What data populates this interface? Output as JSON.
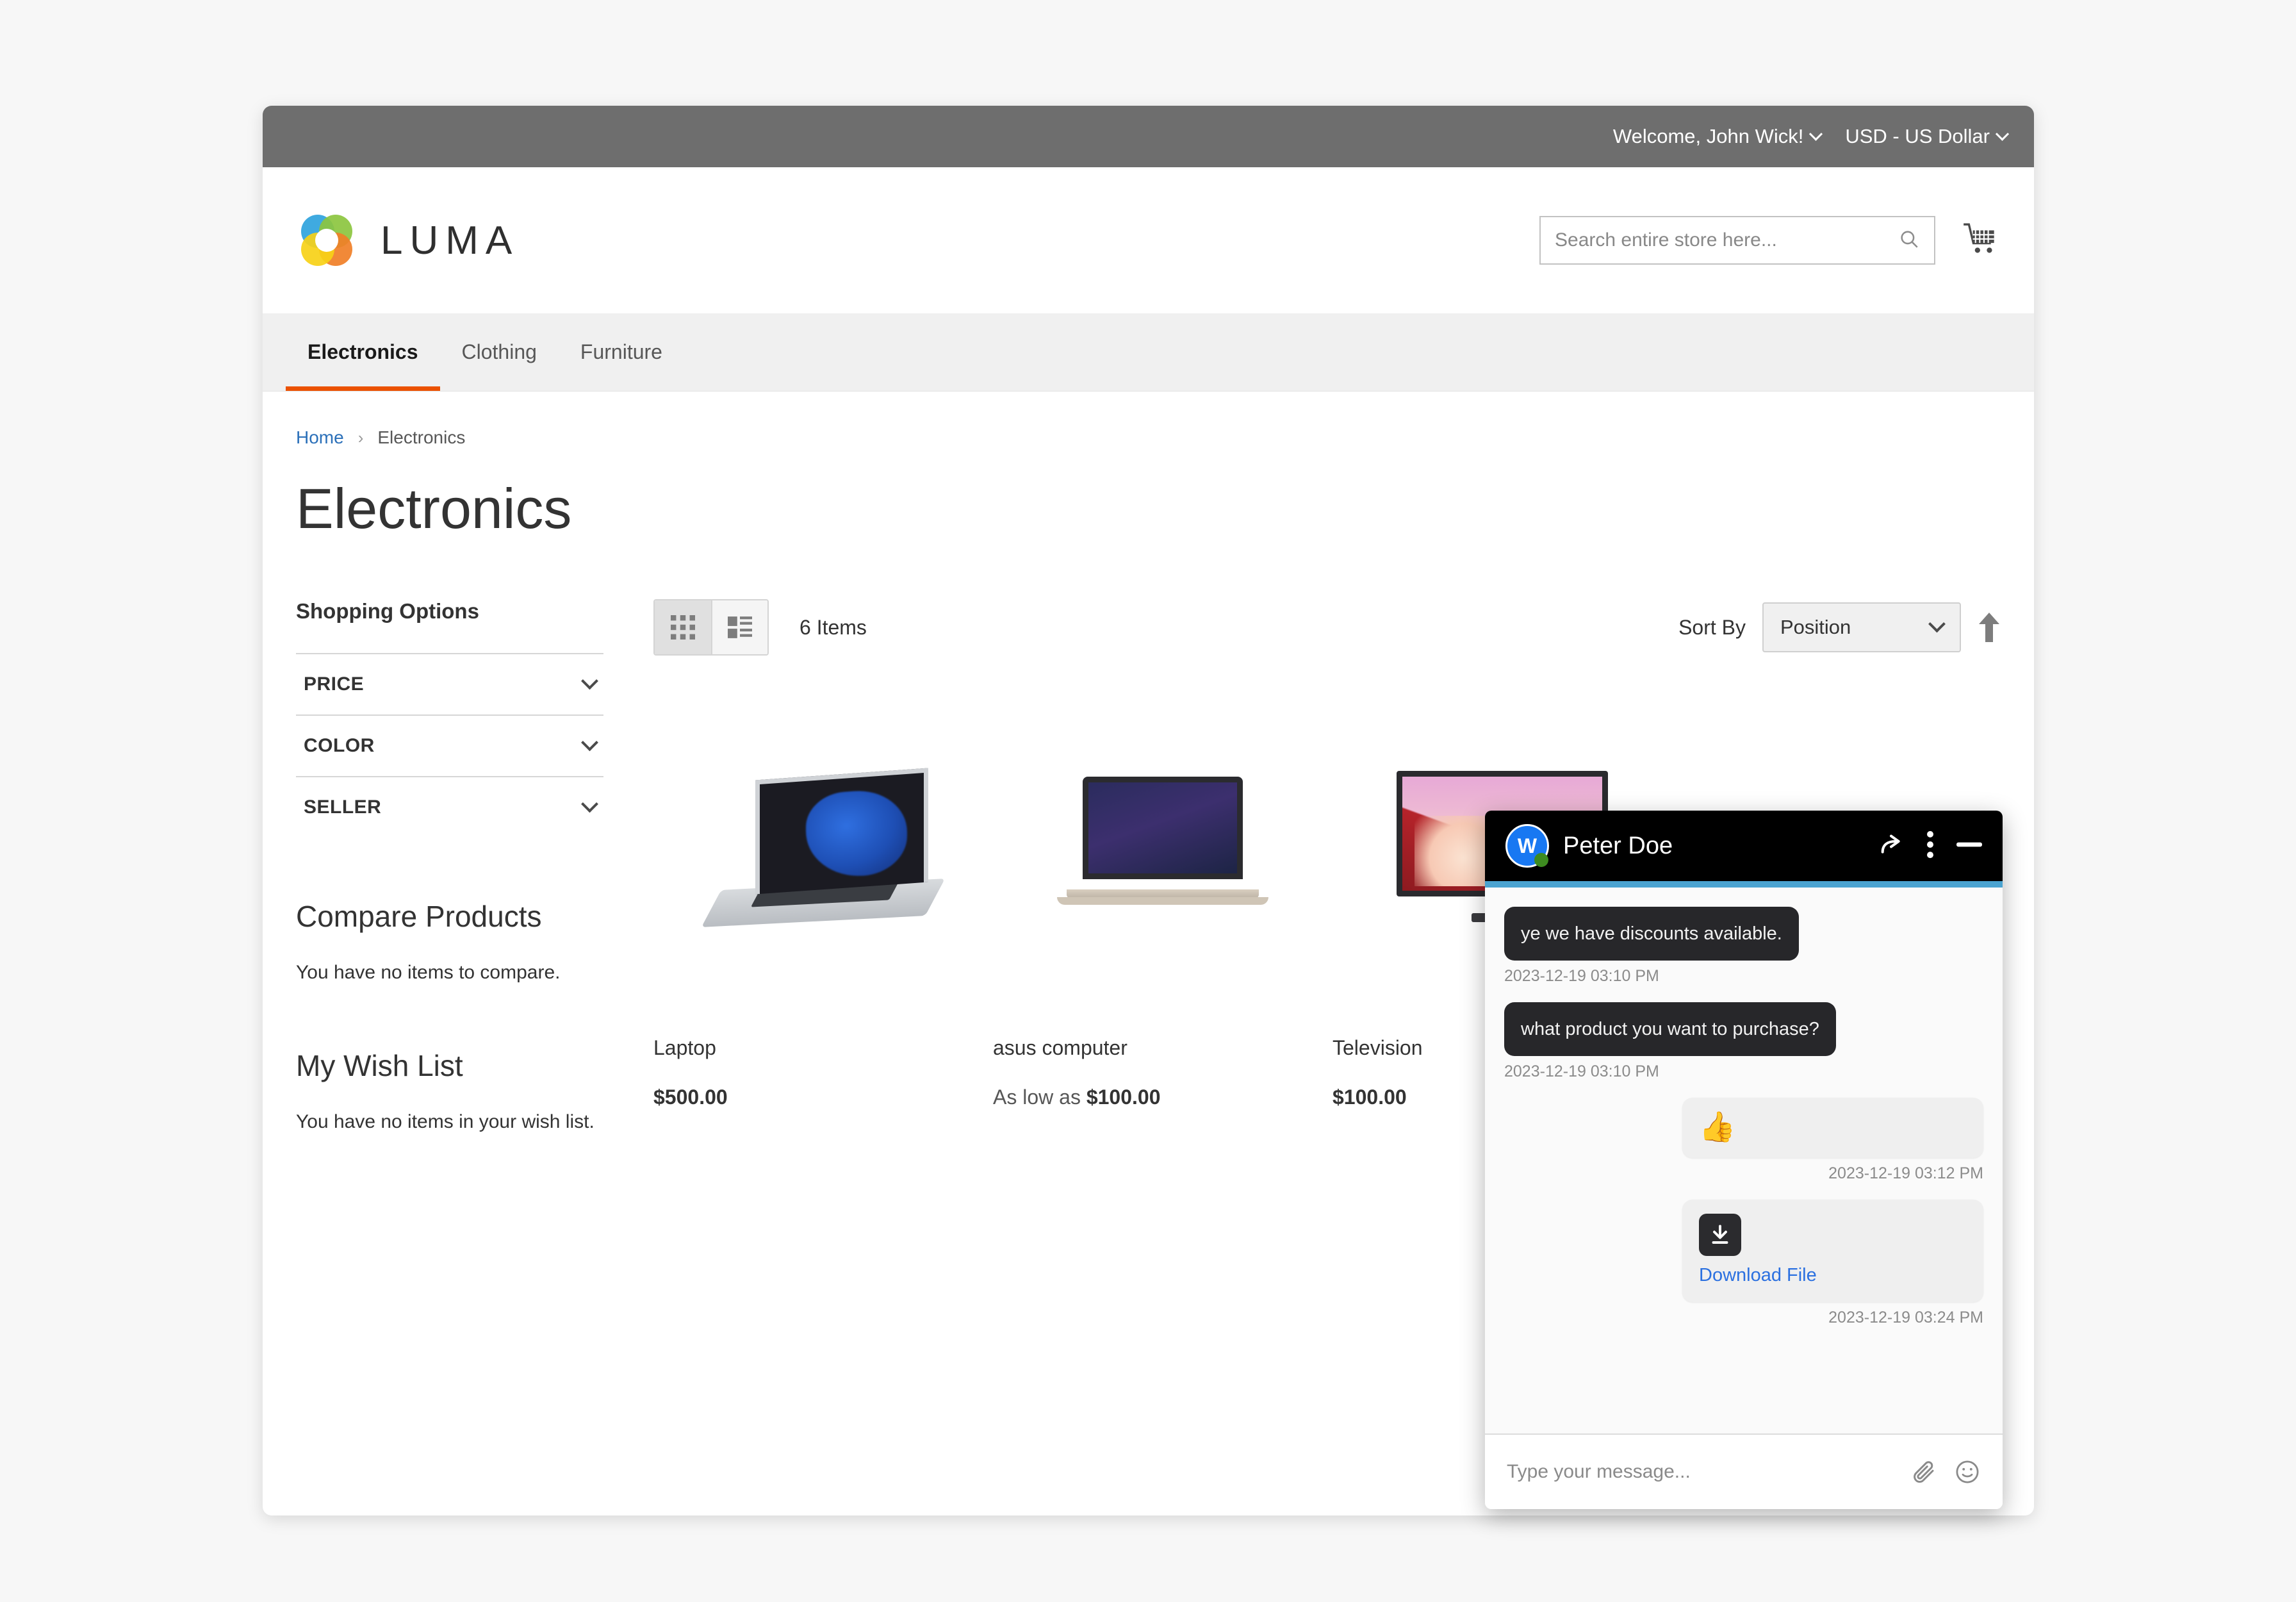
{
  "topbar": {
    "welcome": "Welcome, John Wick!",
    "currency": "USD - US Dollar"
  },
  "header": {
    "logo_text": "LUMA",
    "search_placeholder": "Search entire store here...",
    "search_value": "",
    "cart_icon": "shopping-cart-icon",
    "search_icon": "search-icon"
  },
  "nav": {
    "items": [
      {
        "label": "Electronics",
        "active": true
      },
      {
        "label": "Clothing",
        "active": false
      },
      {
        "label": "Furniture",
        "active": false
      }
    ]
  },
  "breadcrumb": {
    "home": "Home",
    "separator": "›",
    "current": "Electronics"
  },
  "page": {
    "title": "Electronics"
  },
  "sidebar": {
    "shopping_options_title": "Shopping Options",
    "filters": [
      {
        "label": "PRICE"
      },
      {
        "label": "COLOR"
      },
      {
        "label": "SELLER"
      }
    ],
    "compare": {
      "heading": "Compare Products",
      "empty_text": "You have no items to compare."
    },
    "wishlist": {
      "heading": "My Wish List",
      "empty_text": "You have no items in your wish list."
    }
  },
  "toolbar": {
    "grid_view_icon": "grid-view-icon",
    "list_view_icon": "list-view-icon",
    "items_count": "6 Items",
    "sort_label": "Sort By",
    "sort_value": "Position",
    "sort_direction_icon": "arrow-up-icon"
  },
  "products": [
    {
      "name": "Laptop",
      "price_prefix": "",
      "price": "$500.00",
      "image": "laptop-image"
    },
    {
      "name": "asus computer",
      "price_prefix": "As low as ",
      "price": "$100.00",
      "image": "macbook-image"
    },
    {
      "name": "Television",
      "price_prefix": "",
      "price": "$100.00",
      "image": "television-image"
    }
  ],
  "chat": {
    "avatar_initial": "W",
    "contact_name": "Peter Doe",
    "status": "online",
    "accent_color": "#4aa3d0",
    "actions": [
      {
        "icon": "forward-arrow-icon"
      },
      {
        "icon": "three-dots-menu-icon"
      },
      {
        "icon": "minimize-icon"
      }
    ],
    "messages": [
      {
        "direction": "in",
        "type": "text",
        "text": "ye we have discounts available.",
        "time": "2023-12-19 03:10 PM"
      },
      {
        "direction": "in",
        "type": "text",
        "text": "what product you want to purchase?",
        "time": "2023-12-19 03:10 PM"
      },
      {
        "direction": "out",
        "type": "emoji",
        "text": "👍",
        "time": "2023-12-19 03:12 PM"
      },
      {
        "direction": "out",
        "type": "file",
        "text": "Download File",
        "time": "2023-12-19 03:24 PM"
      }
    ],
    "input_placeholder": "Type your message...",
    "input_value": "",
    "attach_icon": "paperclip-icon",
    "emoji_icon": "smiley-icon"
  }
}
